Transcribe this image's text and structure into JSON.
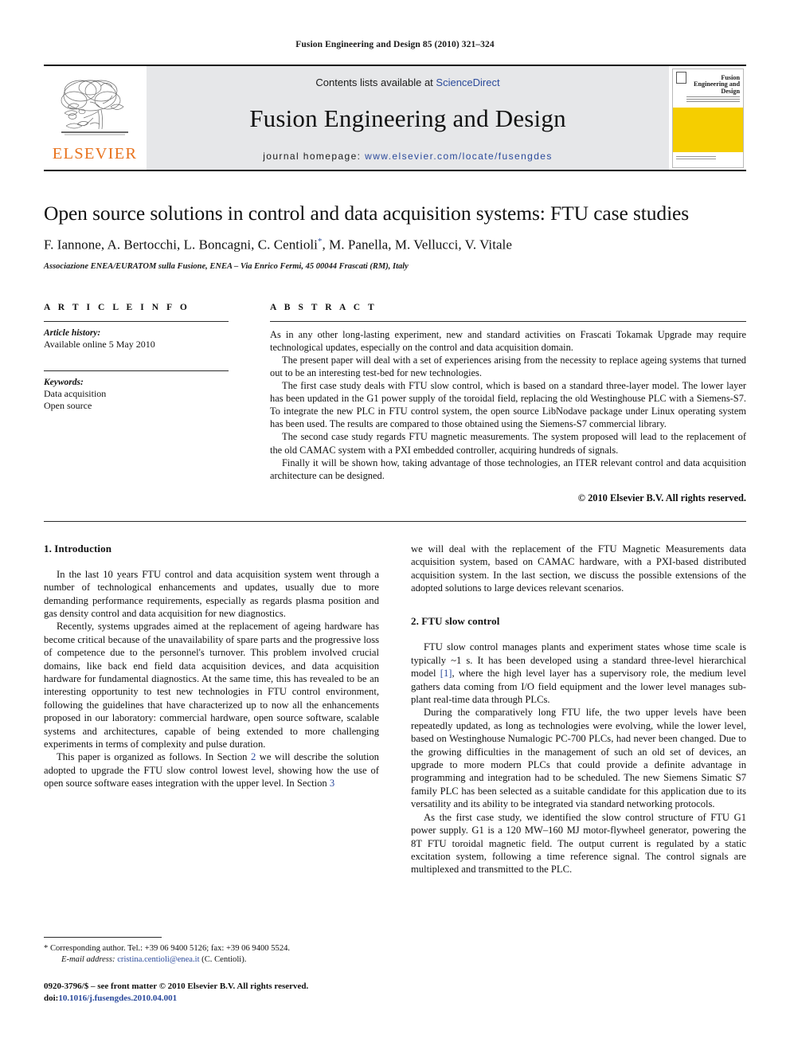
{
  "running_head": "Fusion Engineering and Design 85 (2010) 321–324",
  "masthead": {
    "logo_wordmark": "ELSEVIER",
    "contents_prefix": "Contents lists available at ",
    "contents_link": "ScienceDirect",
    "journal_title": "Fusion Engineering and Design",
    "homepage_prefix": "journal homepage: ",
    "homepage_url": "www.elsevier.com/locate/fusengdes",
    "cover_title": "Fusion Engineering and Design",
    "accent_orange": "#E8721C",
    "accent_blue": "#2b4a9b",
    "cover_yellow": "#F5CE00",
    "band_gray": "#e6e7e9"
  },
  "article": {
    "title": "Open source solutions in control and data acquisition systems: FTU case studies",
    "authors": "F. Iannone, A. Bertocchi, L. Boncagni, C. Centioli",
    "authors_tail": ", M. Panella, M. Vellucci, V. Vitale",
    "corresponding_marker": "*",
    "affiliation": "Associazione ENEA/EURATOM sulla Fusione, ENEA – Via Enrico Fermi, 45 00044 Frascati (RM), Italy"
  },
  "article_info": {
    "heading": "A R T I C L E    I N F O",
    "history_label": "Article history:",
    "history_value": "Available online 5 May 2010",
    "keywords_label": "Keywords:",
    "keywords": [
      "Data acquisition",
      "Open source"
    ]
  },
  "abstract": {
    "heading": "A B S T R A C T",
    "paragraphs": [
      "As in any other long-lasting experiment, new and standard activities on Frascati Tokamak Upgrade may require technological updates, especially on the control and data acquisition domain.",
      "The present paper will deal with a set of experiences arising from the necessity to replace ageing systems that turned out to be an interesting test-bed for new technologies.",
      "The first case study deals with FTU slow control, which is based on a standard three-layer model. The lower layer has been updated in the G1 power supply of the toroidal field, replacing the old Westinghouse PLC with a Siemens-S7. To integrate the new PLC in FTU control system, the open source LibNodave package under Linux operating system has been used. The results are compared to those obtained using the Siemens-S7 commercial library.",
      "The second case study regards FTU magnetic measurements. The system proposed will lead to the replacement of the old CAMAC system with a PXI embedded controller, acquiring hundreds of signals.",
      "Finally it will be shown how, taking advantage of those technologies, an ITER relevant control and data acquisition architecture can be designed."
    ],
    "copyright": "© 2010 Elsevier B.V. All rights reserved."
  },
  "body": {
    "section1_heading": "1.  Introduction",
    "section1_p1": "In the last 10 years FTU control and data acquisition system went through a number of technological enhancements and updates, usually due to more demanding performance requirements, especially as regards plasma position and gas density control and data acquisition for new diagnostics.",
    "section1_p2": "Recently, systems upgrades aimed at the replacement of ageing hardware has become critical because of the unavailability of spare parts and the progressive loss of competence due to the personnel's turnover. This problem involved crucial domains, like back end field data acquisition devices, and data acquisition hardware for fundamental diagnostics. At the same time, this has revealed to be an interesting opportunity to test new technologies in FTU control environment, following the guidelines that have characterized up to now all the enhancements proposed in our laboratory: commercial hardware, open source software, scalable systems and architectures, capable of being extended to more challenging experiments in terms of complexity and pulse duration.",
    "section1_p3_a": "This paper is organized as follows. In Section ",
    "section1_p3_link1": "2",
    "section1_p3_b": " we will describe the solution adopted to upgrade the FTU slow control lowest level, showing how the use of open source software eases integration with the upper level. In Section ",
    "section1_p3_link2": "3",
    "section1_p3_c": " we will deal with the replacement of the FTU Magnetic Measurements data acquisition system, based on CAMAC hardware, with a PXI-based distributed acquisition system. In the last section, we discuss the possible extensions of the adopted solutions to large devices relevant scenarios.",
    "section2_heading": "2.  FTU slow control",
    "section2_p1_a": "FTU slow control manages plants and experiment states whose time scale is typically ~1 s. It has been developed using a standard three-level hierarchical model ",
    "section2_p1_link": "[1]",
    "section2_p1_b": ", where the high level layer has a supervisory role, the medium level gathers data coming from I/O field equipment and the lower level manages sub-plant real-time data through PLCs.",
    "section2_p2": "During the comparatively long FTU life, the two upper levels have been repeatedly updated, as long as technologies were evolving, while the lower level, based on Westinghouse Numalogic PC-700 PLCs, had never been changed. Due to the growing difficulties in the management of such an old set of devices, an upgrade to more modern PLCs that could provide a definite advantage in programming and integration had to be scheduled. The new Siemens Simatic S7 family PLC has been selected as a suitable candidate for this application due to its versatility and its ability to be integrated via standard networking protocols.",
    "section2_p3": "As the first case study, we identified the slow control structure of FTU G1 power supply. G1 is a 120 MW–160 MJ motor-flywheel generator, powering the 8T FTU toroidal magnetic field. The output current is regulated by a static excitation system, following a time reference signal. The control signals are multiplexed and transmitted to the PLC."
  },
  "footnotes": {
    "corresponding": "* Corresponding author. Tel.: +39 06 9400 5126; fax: +39 06 9400 5524.",
    "email_label": "E-mail address:",
    "email": "cristina.centioli@enea.it",
    "email_suffix": " (C. Centioli).",
    "issn_line": "0920-3796/$ – see front matter © 2010 Elsevier B.V. All rights reserved.",
    "doi_label": "doi:",
    "doi_value": "10.1016/j.fusengdes.2010.04.001"
  }
}
